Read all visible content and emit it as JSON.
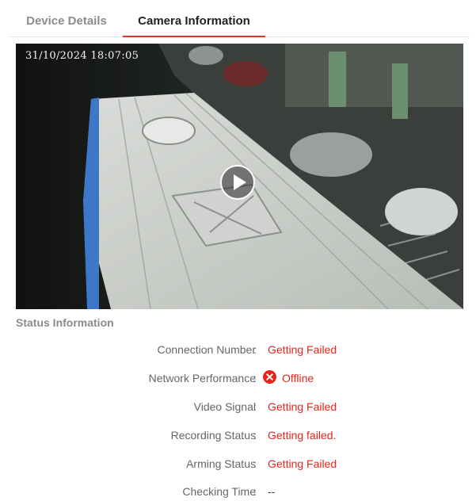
{
  "tabs": [
    {
      "label": "Device Details",
      "active": false
    },
    {
      "label": "Camera Information",
      "active": true
    }
  ],
  "video": {
    "timestamp": "31/10/2024 18:07:05",
    "play_icon": "play-icon"
  },
  "status": {
    "title": "Status Information",
    "rows": [
      {
        "label": "Connection Number",
        "value": "Getting Failed"
      },
      {
        "label": "Network Performance",
        "value": "Offline",
        "icon": "error-circle-icon"
      },
      {
        "label": "Video Signal",
        "value": "Getting Failed"
      },
      {
        "label": "Recording Status",
        "value": "Getting failed."
      },
      {
        "label": "Arming Status",
        "value": "Getting Failed"
      },
      {
        "label": "Checking Time",
        "value": "--"
      }
    ],
    "colon": ":"
  },
  "colors": {
    "accent": "#e0332c",
    "error_text": "#e8231b",
    "muted_text": "#8a8a8a"
  }
}
